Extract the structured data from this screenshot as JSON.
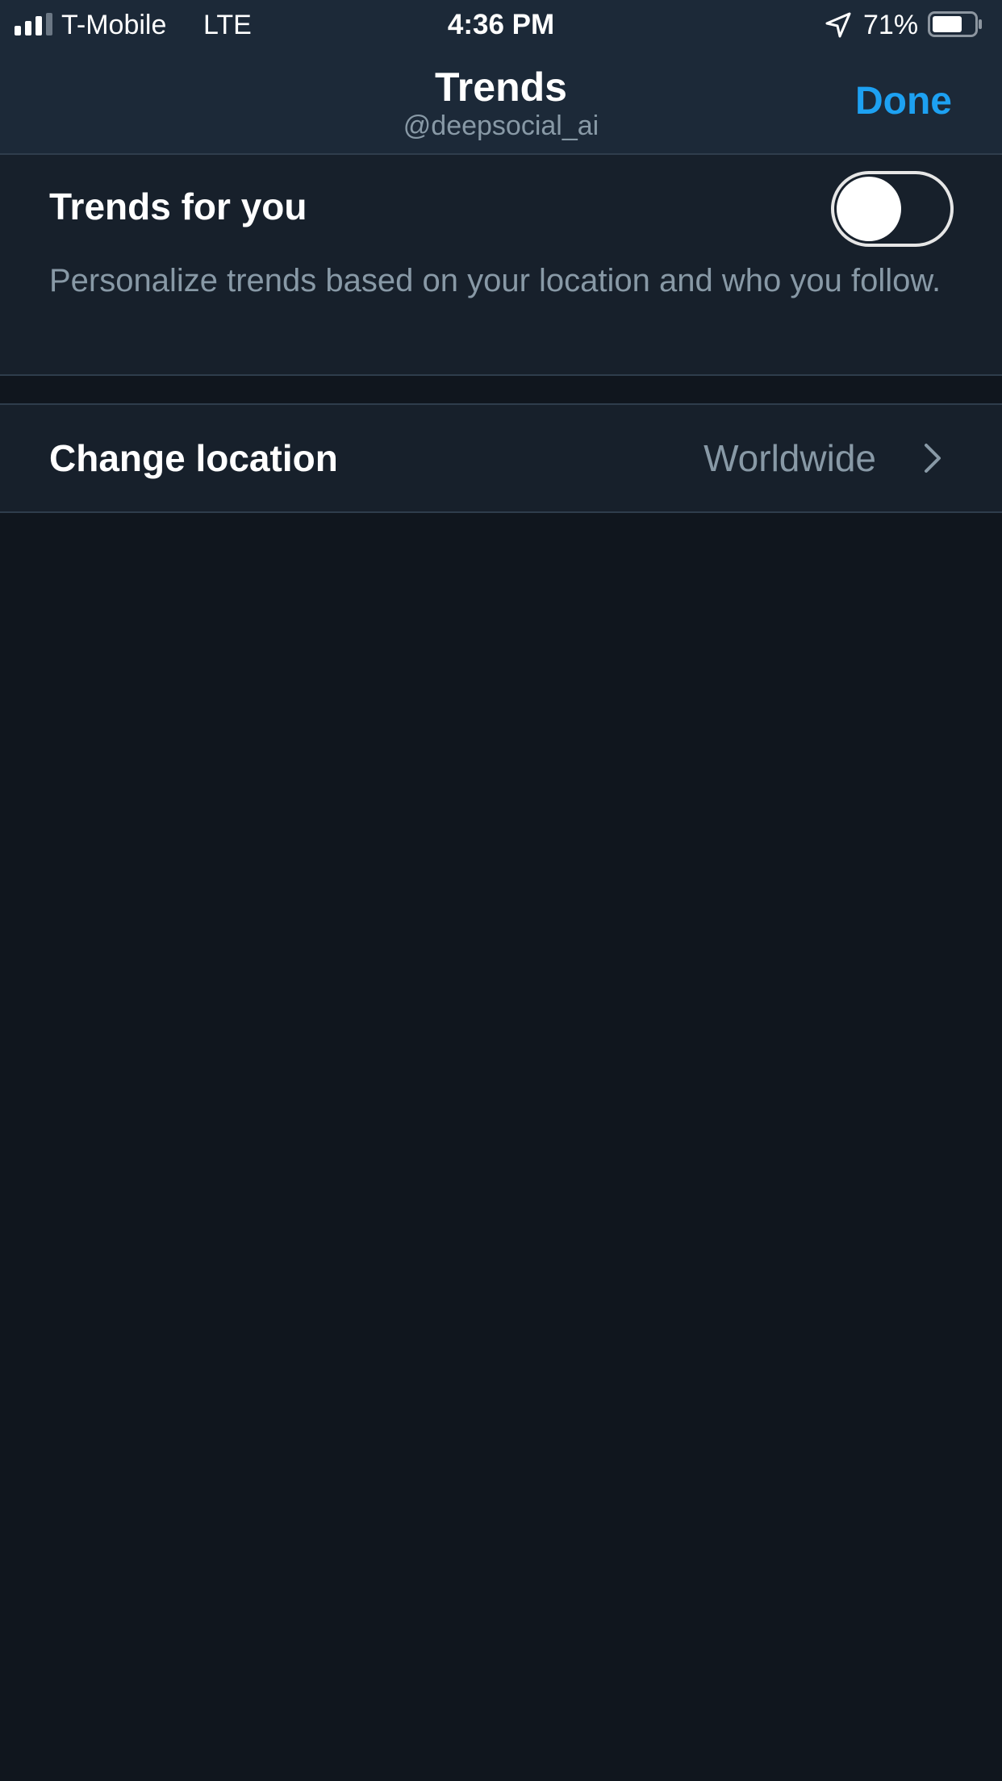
{
  "status_bar": {
    "carrier": "T-Mobile",
    "network": "LTE",
    "time": "4:36 PM",
    "battery_percent": "71%",
    "signal_bars_active": 3,
    "signal_bars_total": 4,
    "battery_level": 0.71,
    "icons": [
      "signal-icon",
      "location-arrow-icon",
      "battery-icon"
    ]
  },
  "nav": {
    "title": "Trends",
    "subtitle": "@deepsocial_ai",
    "done_label": "Done"
  },
  "trends_for_you": {
    "label": "Trends for you",
    "description": "Personalize trends based on your location and who you follow.",
    "toggle_on": false
  },
  "change_location": {
    "label": "Change location",
    "value": "Worldwide",
    "icon": "chevron-right-icon"
  },
  "colors": {
    "accent": "#1da1f2",
    "background": "#10161e",
    "row_background": "#17202b",
    "header_background": "#1c2938",
    "secondary_text": "#8899a6",
    "divider": "#2f3d4c"
  }
}
